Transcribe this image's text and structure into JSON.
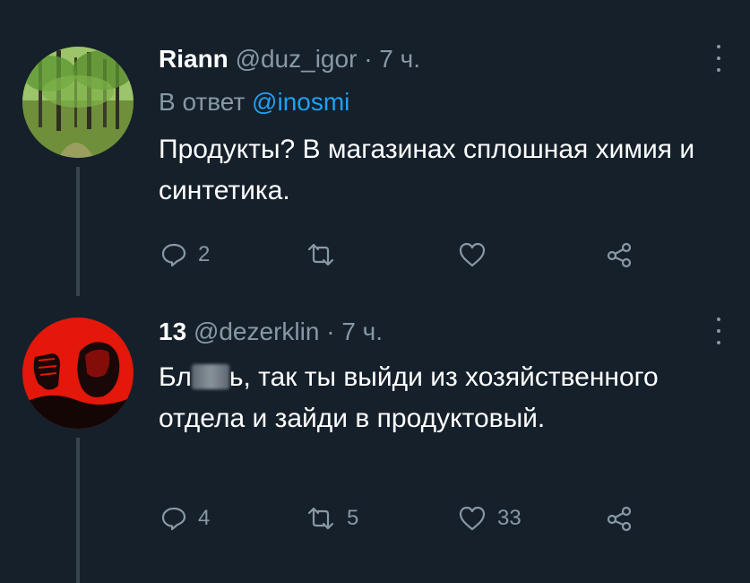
{
  "tweets": [
    {
      "name": "Riann",
      "handle": "@duz_igor",
      "separator": "·",
      "time": "7 ч.",
      "reply_prefix": "В ответ",
      "reply_to": "@inosmi",
      "text": "Продукты?  В магазинах сплошная химия и синтетика.",
      "avatar_icon": "forest-photo",
      "actions": {
        "reply_count": "2",
        "retweet_count": "",
        "like_count": "",
        "share_icon": "share-icon"
      }
    },
    {
      "name": "13",
      "handle": "@dezerklin",
      "separator": "·",
      "time": "7 ч.",
      "text_before": "Бл",
      "text_after": "ь, так ты выйди из хозяйственного отдела и зайди в продуктовый.",
      "avatar_icon": "red-fist-poster",
      "actions": {
        "reply_count": "4",
        "retweet_count": "5",
        "like_count": "33",
        "share_icon": "share-icon"
      }
    }
  ],
  "colors": {
    "background": "#15202b",
    "text_primary": "#ffffff",
    "text_secondary": "#8899a6",
    "link": "#1da1f2",
    "thread_line": "#38444d"
  }
}
